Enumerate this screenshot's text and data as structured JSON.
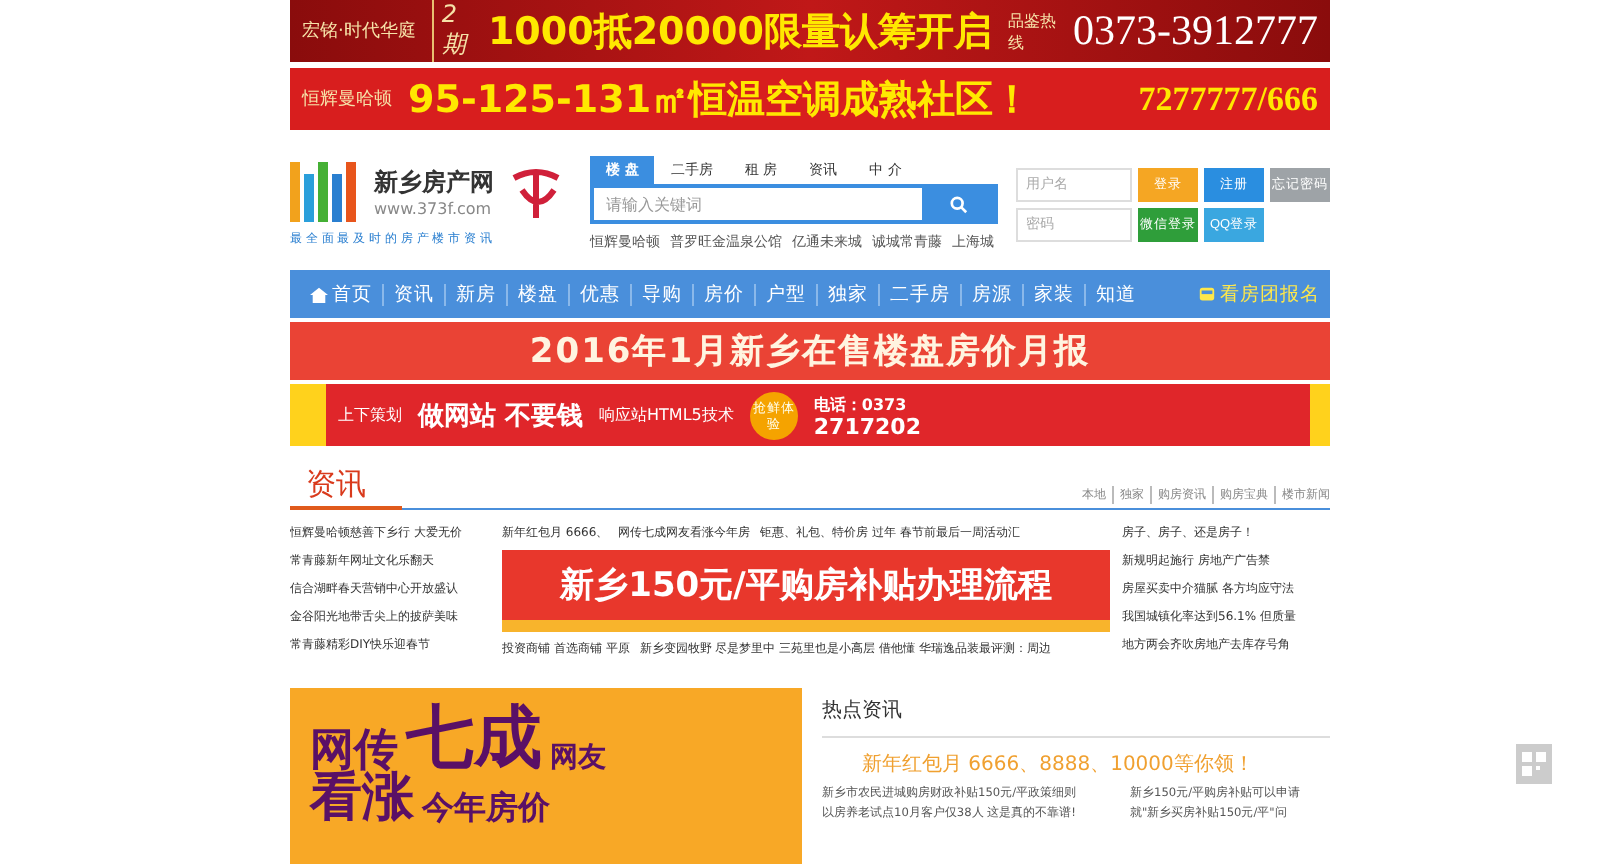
{
  "top_banners": [
    {
      "kind": "dark",
      "brand": "宏铭·时代华庭",
      "tag": "2期",
      "headline": "1000抵20000限量认筹开启",
      "phone_label": "品鉴热线",
      "phone": "0373-3912777"
    },
    {
      "kind": "red",
      "brand": "恒辉曼哈顿",
      "headline": "95-125-131㎡恒温空调成熟社区！",
      "phone": "7277777/666"
    }
  ],
  "header": {
    "logo": {
      "name": "新乡房产网",
      "url": "www.373f.com",
      "slogan": "最 全 面 最 及 时 的 房 产 楼 市 资 讯"
    },
    "search": {
      "tabs": [
        {
          "label": "楼 盘",
          "selected": true
        },
        {
          "label": "二手房",
          "selected": false
        },
        {
          "label": "租 房",
          "selected": false
        },
        {
          "label": "资讯",
          "selected": false
        },
        {
          "label": "中 介",
          "selected": false
        }
      ],
      "placeholder": "请输入关键词",
      "hot": [
        "恒辉曼哈顿",
        "普罗旺金温泉公馆",
        "亿通未来城",
        "诚城常青藤",
        "上海城"
      ]
    },
    "login": {
      "username_placeholder": "用户名",
      "password_placeholder": "密码",
      "buttons": [
        {
          "kind": "orange",
          "label": "登录"
        },
        {
          "kind": "blue",
          "label": "注册"
        },
        {
          "kind": "grey",
          "label": "忘记密码"
        },
        {
          "kind": "green",
          "label": "微信登录"
        },
        {
          "kind": "sky",
          "label": "QQ登录"
        }
      ]
    }
  },
  "nav": {
    "items": [
      "首页",
      "资讯",
      "新房",
      "楼盘",
      "优惠",
      "导购",
      "房价",
      "户型",
      "独家",
      "二手房",
      "房源",
      "家装",
      "知道"
    ],
    "signup": "看房团报名"
  },
  "report_banner": "2016年1月新乡在售楼盘房价月报",
  "ad_banner": {
    "brand": "上下策划",
    "headline": "做网站 不要钱",
    "sub": "响应站HTML5技术",
    "badge": "抢鲜体验",
    "phone": "电话：0373",
    "phone_number": "2717202"
  },
  "news": {
    "title": "资讯",
    "links": [
      "本地",
      "独家",
      "购房资讯",
      "购房宝典",
      "楼市新闻"
    ],
    "left": [
      "恒辉曼哈顿慈善下乡行 大爱无价",
      "常青藤新年网址文化乐翻天",
      "信合湖畔春天营销中心开放盛认",
      "金谷阳光地带舌尖上的披萨美味",
      "常青藤精彩DIY快乐迎春节"
    ],
    "top": [
      "新年红包月 6666、",
      "网传七成网友看涨今年房",
      "钜惠、礼包、特价房 过年 春节前最后一周活动汇"
    ],
    "promo": "新乡150元/平购房补贴办理流程",
    "bottom": [
      "投资商铺 首选商铺 平原",
      "新乡变园牧野 尽是梦里中 三苑里也是小高层 借他懂 华瑞逸品装最评测：周边"
    ],
    "right": [
      "房子、房子、还是房子！",
      "新规明起施行 房地产广告禁",
      "房屋买卖中介猫腻 各方均应守法",
      "我国城镇化率达到56.1% 但质量",
      "地方两会齐吹房地产去库存号角"
    ]
  },
  "feature": {
    "line1a": "网传",
    "line1b": "七成",
    "line1c": "网友",
    "line2a": "看涨",
    "line2b": "今年房价"
  },
  "hot_news": {
    "title": "热点资讯",
    "headline": "新年红包月 6666、8888、10000等你领！",
    "items": [
      "新乡市农民进城购房财政补贴150元/平政策细则",
      "新乡150元/平购房补贴可以申请",
      "以房养老试点10月客户仅38人 这是真的不靠谱!",
      "就\"新乡买房补贴150元/平\"问"
    ]
  }
}
